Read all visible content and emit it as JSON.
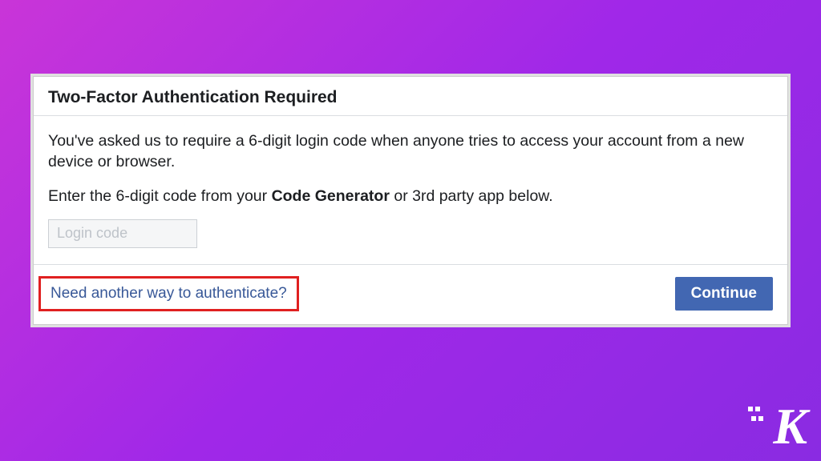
{
  "dialog": {
    "title": "Two-Factor Authentication Required",
    "paragraph1": "You've asked us to require a 6-digit login code when anyone tries to access your account from a new device or browser.",
    "paragraph2_prefix": "Enter the 6-digit code from your ",
    "paragraph2_strong": "Code Generator",
    "paragraph2_suffix": " or 3rd party app below.",
    "input_placeholder": "Login code",
    "input_value": "",
    "alt_auth_link": "Need another way to authenticate?",
    "continue_button": "Continue"
  },
  "logo": {
    "letter": "K"
  }
}
